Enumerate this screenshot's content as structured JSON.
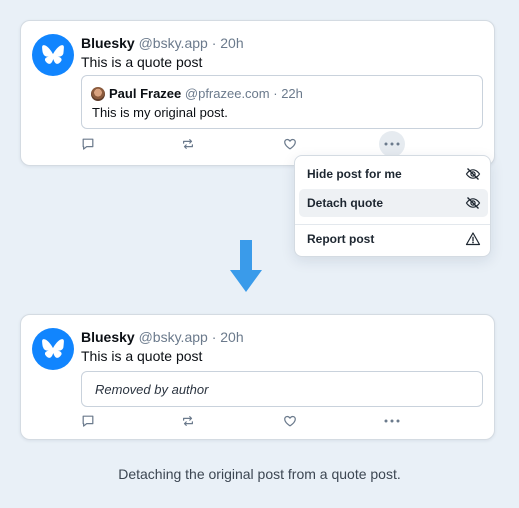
{
  "top_post": {
    "display_name": "Bluesky",
    "handle": "@bsky.app",
    "time": "· 20h",
    "text": "This is a quote post",
    "avatar_icon": "butterfly-logo-icon",
    "quoted": {
      "display_name": "Paul Frazee",
      "handle": "@pfrazee.com",
      "time": "· 22h",
      "text": "This is my original post."
    },
    "actions": [
      "reply-icon",
      "repost-icon",
      "like-icon",
      "more-options-icon"
    ]
  },
  "menu": {
    "items": [
      {
        "label": "Hide post for me",
        "icon": "eye-slash-icon",
        "highlighted": false
      },
      {
        "label": "Detach quote",
        "icon": "eye-slash-icon",
        "highlighted": true
      },
      {
        "label": "Report post",
        "icon": "warning-triangle-icon",
        "highlighted": false
      }
    ]
  },
  "transition_icon": "down-arrow-icon",
  "bottom_post": {
    "display_name": "Bluesky",
    "handle": "@bsky.app",
    "time": "· 20h",
    "text": "This is a quote post",
    "removed_text": "Removed by author",
    "actions": [
      "reply-icon",
      "repost-icon",
      "like-icon",
      "more-options-icon"
    ]
  },
  "caption": "Detaching the original post from a quote post.",
  "colors": {
    "brand_blue": "#1185fe",
    "arrow_blue": "#3a9bea",
    "background": "#e9f0f7",
    "muted_text": "#6b7a8c"
  }
}
